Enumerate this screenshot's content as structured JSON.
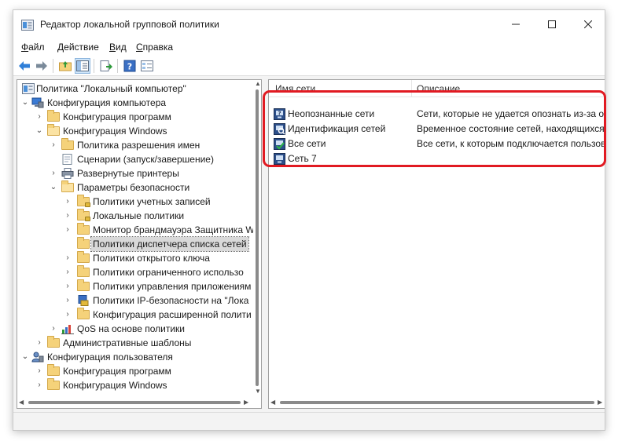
{
  "window": {
    "title": "Редактор локальной групповой политики",
    "controls": {
      "minimize": "—",
      "maximize": "☐",
      "close": "✕"
    }
  },
  "menu": {
    "items": [
      {
        "underline": "Ф",
        "rest": "айл"
      },
      {
        "underline": "Д",
        "rest": "ействие"
      },
      {
        "underline": "В",
        "rest": "ид"
      },
      {
        "underline": "С",
        "rest": "правка"
      }
    ]
  },
  "toolbar": {
    "icons": [
      "back-arrow-icon",
      "forward-arrow-icon",
      "up-folder-icon",
      "show-hide-tree-icon",
      "export-list-icon",
      "help-icon",
      "properties-icon"
    ]
  },
  "tree": {
    "items": [
      {
        "label": "Политика \"Локальный компьютер\"",
        "arrow": "",
        "icon": "policy-icon"
      },
      {
        "label": "Конфигурация компьютера",
        "arrow": "⌄",
        "icon": "computer-icon"
      },
      {
        "label": "Конфигурация программ",
        "arrow": "›",
        "icon": "folder-icon"
      },
      {
        "label": "Конфигурация Windows",
        "arrow": "⌄",
        "icon": "folder-icon"
      },
      {
        "label": "Политика разрешения имен",
        "arrow": "›",
        "icon": "folder-icon"
      },
      {
        "label": "Сценарии (запуск/завершение)",
        "arrow": "",
        "icon": "scripts-icon"
      },
      {
        "label": "Развернутые принтеры",
        "arrow": "›",
        "icon": "printer-icon"
      },
      {
        "label": "Параметры безопасности",
        "arrow": "⌄",
        "icon": "folder-icon"
      },
      {
        "label": "Политики учетных записей",
        "arrow": "›",
        "icon": "folder-lock-icon"
      },
      {
        "label": "Локальные политики",
        "arrow": "›",
        "icon": "folder-lock-icon"
      },
      {
        "label": "Монитор брандмауэра Защитника W",
        "arrow": "›",
        "icon": "folder-icon"
      },
      {
        "label": "Политики диспетчера списка сетей",
        "arrow": "",
        "icon": "folder-icon",
        "selected": true
      },
      {
        "label": "Политики открытого ключа",
        "arrow": "›",
        "icon": "folder-icon"
      },
      {
        "label": "Политики ограниченного использо",
        "arrow": "›",
        "icon": "folder-icon"
      },
      {
        "label": "Политики управления приложениям",
        "arrow": "›",
        "icon": "folder-icon"
      },
      {
        "label": "Политики IP-безопасности на \"Лока",
        "arrow": "›",
        "icon": "ip-security-icon"
      },
      {
        "label": "Конфигурация расширенной полити",
        "arrow": "›",
        "icon": "folder-icon"
      },
      {
        "label": "QoS на основе политики",
        "arrow": "›",
        "icon": "qos-chart-icon"
      },
      {
        "label": "Административные шаблоны",
        "arrow": "›",
        "icon": "folder-icon"
      },
      {
        "label": "Конфигурация пользователя",
        "arrow": "⌄",
        "icon": "user-config-icon"
      },
      {
        "label": "Конфигурация программ",
        "arrow": "›",
        "icon": "folder-icon"
      },
      {
        "label": "Конфигурация Windows",
        "arrow": "›",
        "icon": "folder-icon"
      }
    ]
  },
  "list": {
    "columns": [
      "Имя сети",
      "Описание"
    ],
    "rows": [
      {
        "name": "Неопознанные сети",
        "desc": "Сети, которые не удается опознать из-за оц",
        "icon": "unidentified-network-icon"
      },
      {
        "name": "Идентификация сетей",
        "desc": "Временное состояние сетей, находящихся i",
        "icon": "identifying-network-icon"
      },
      {
        "name": "Все сети",
        "desc": "Все сети, к которым подключается пользов",
        "icon": "all-networks-icon"
      },
      {
        "name": "Сеть 7",
        "desc": "",
        "icon": "network-icon"
      }
    ]
  },
  "colors": {
    "highlight": "#e11a22",
    "selection": "#d9d9d9",
    "accent": "#1e6fd0"
  }
}
